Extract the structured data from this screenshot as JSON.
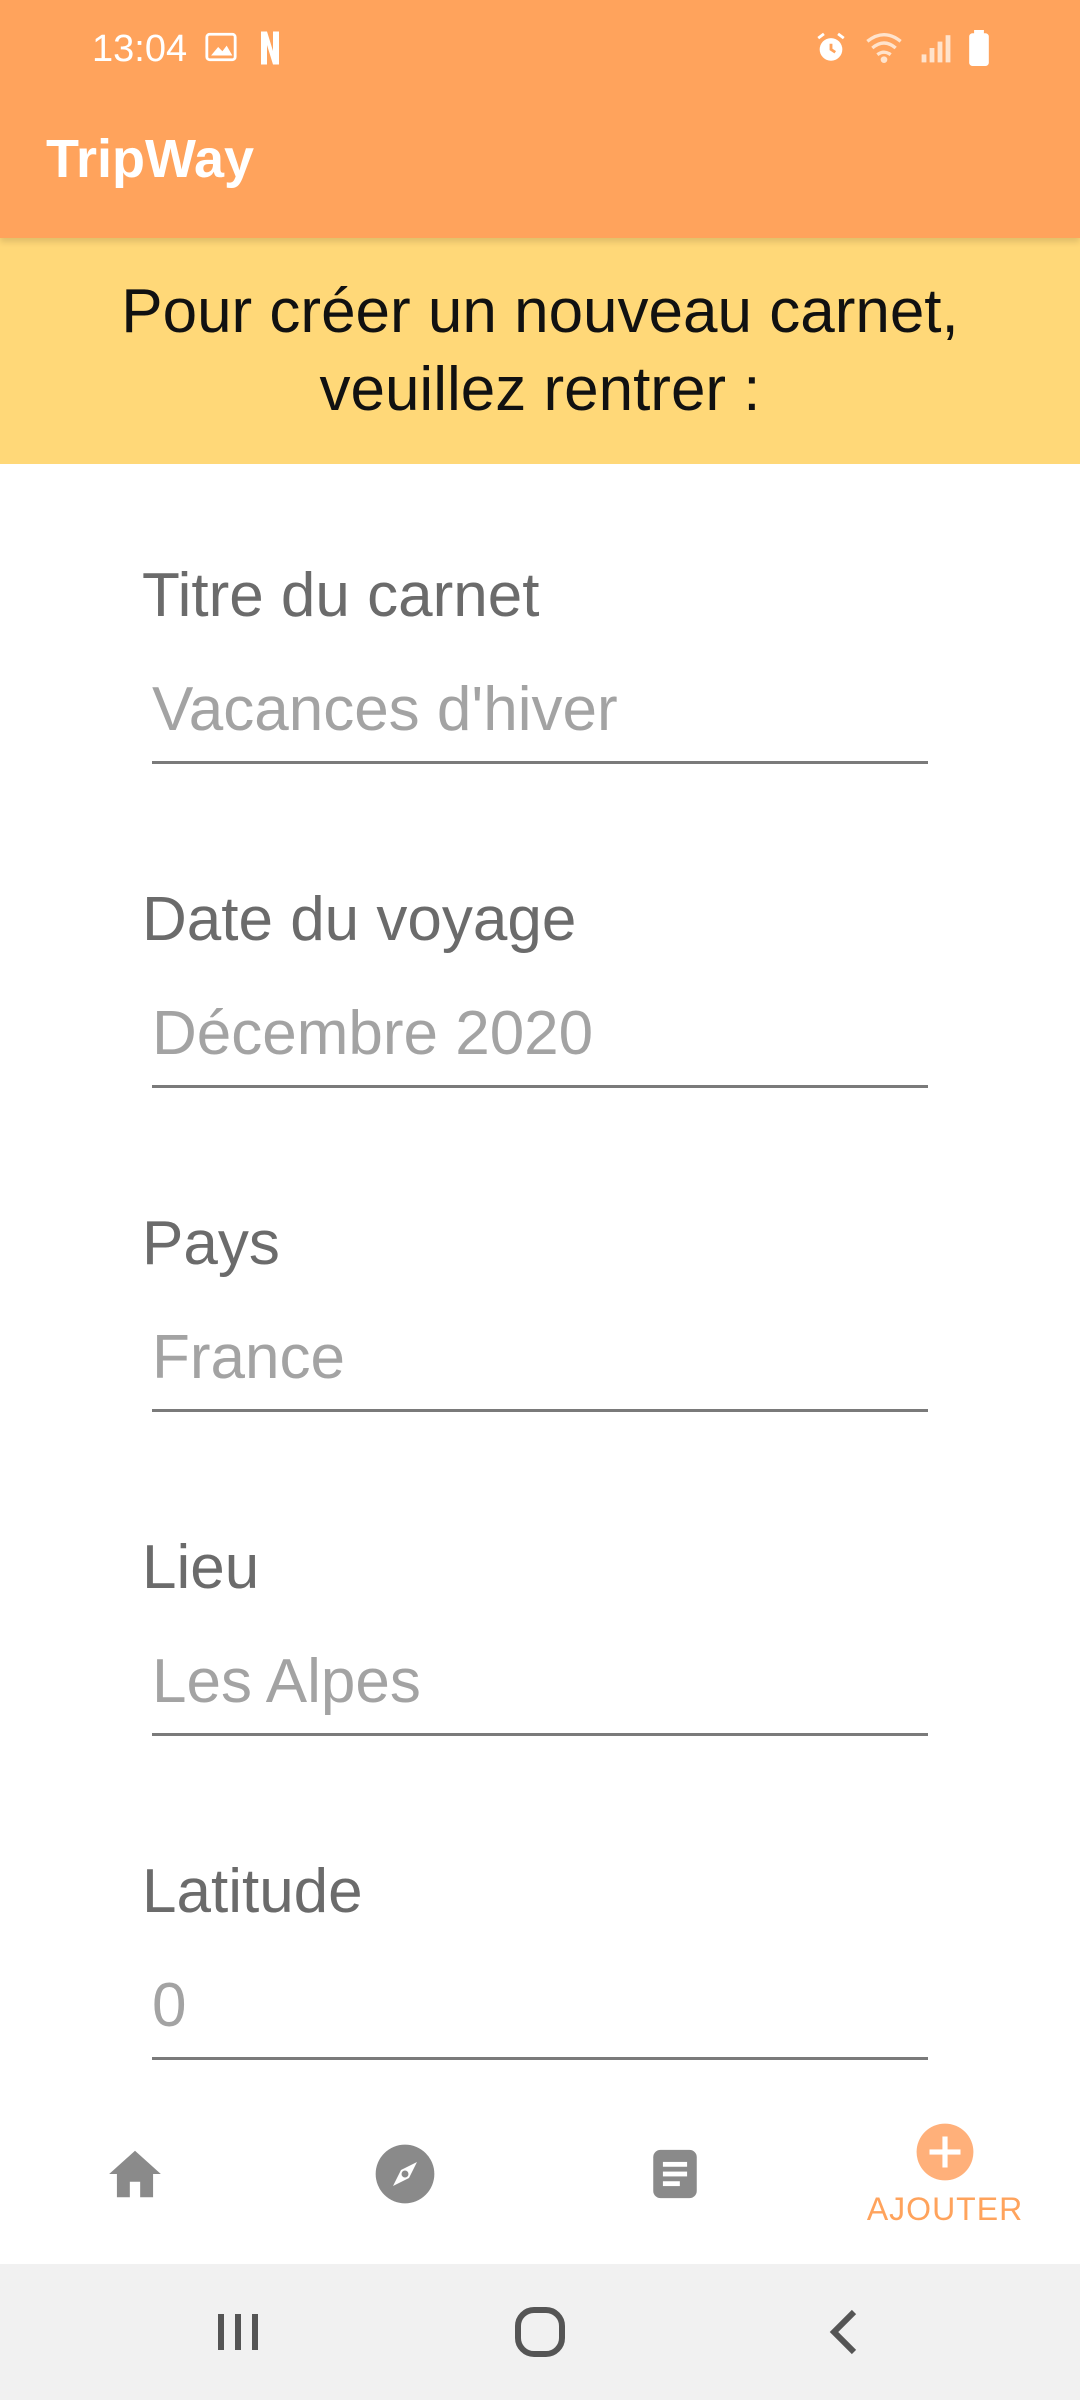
{
  "status_bar": {
    "time": "13:04",
    "left_icons": [
      "image-icon",
      "netflix-icon"
    ],
    "right_icons": [
      "alarm-icon",
      "wifi-icon",
      "signal-icon",
      "battery-icon"
    ]
  },
  "app_bar": {
    "title": "TripWay",
    "color": "#FFA35C"
  },
  "banner": {
    "text": "Pour créer un nouveau carnet, veuillez rentrer :",
    "color": "#FFD878"
  },
  "form": {
    "fields": [
      {
        "label": "Titre du carnet",
        "placeholder": "Vacances d'hiver",
        "value": ""
      },
      {
        "label": "Date du voyage",
        "placeholder": "Décembre 2020",
        "value": ""
      },
      {
        "label": "Pays",
        "placeholder": "France",
        "value": ""
      },
      {
        "label": "Lieu",
        "placeholder": "Les Alpes",
        "value": ""
      },
      {
        "label": "Latitude",
        "placeholder": "0",
        "value": ""
      }
    ]
  },
  "bottom_nav": {
    "items": [
      {
        "icon": "home-icon",
        "label": "",
        "active": false
      },
      {
        "icon": "compass-icon",
        "label": "",
        "active": false
      },
      {
        "icon": "document-icon",
        "label": "",
        "active": false
      },
      {
        "icon": "add-circle-icon",
        "label": "AJOUTER",
        "active": true
      }
    ],
    "active_color": "#FFA35C",
    "inactive_color": "#8A8A8A"
  },
  "system_nav": {
    "buttons": [
      "recents-icon",
      "home-circle-icon",
      "back-icon"
    ]
  }
}
